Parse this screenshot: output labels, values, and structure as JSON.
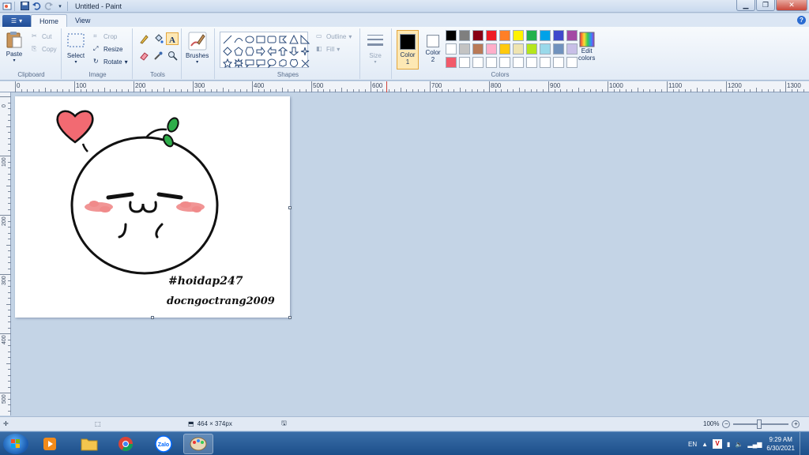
{
  "window": {
    "title": "Untitled - Paint"
  },
  "tabs": [
    {
      "label": "Home",
      "active": true
    },
    {
      "label": "View",
      "active": false
    }
  ],
  "ribbon": {
    "clipboard": {
      "label": "Clipboard",
      "paste": "Paste",
      "cut": "Cut",
      "copy": "Copy"
    },
    "image": {
      "label": "Image",
      "select": "Select",
      "crop": "Crop",
      "resize": "Resize",
      "rotate": "Rotate"
    },
    "tools": {
      "label": "Tools"
    },
    "brushes": {
      "label": "Brushes"
    },
    "shapes": {
      "label": "Shapes",
      "outline": "Outline",
      "fill": "Fill"
    },
    "size": {
      "label": "Size"
    },
    "colors": {
      "label": "Colors",
      "color1": "Color",
      "color1_num": "1",
      "color2": "Color",
      "color2_num": "2",
      "edit": "Edit",
      "edit2": "colors",
      "color1_value": "#000000",
      "color2_value": "#ffffff",
      "palette_row1": [
        "#000000",
        "#7f7f7f",
        "#880015",
        "#ed1c24",
        "#ff7f27",
        "#fff200",
        "#22b14c",
        "#00a2e8",
        "#3f48cc",
        "#a349a4"
      ],
      "palette_row2": [
        "#ffffff",
        "#c3c3c3",
        "#b97a57",
        "#ffaec9",
        "#ffc90e",
        "#efe4b0",
        "#b5e61d",
        "#99d9ea",
        "#7092be",
        "#c8bfe7"
      ],
      "palette_row3": [
        "#f25a6a",
        "#ffffff",
        "#ffffff",
        "#ffffff",
        "#ffffff",
        "#ffffff",
        "#ffffff",
        "#ffffff",
        "#ffffff",
        "#ffffff"
      ]
    }
  },
  "ruler": {
    "h_labels": [
      "0",
      "100",
      "200",
      "300",
      "400",
      "500",
      "600",
      "700",
      "800",
      "900",
      "1000",
      "1100",
      "1200",
      "1300"
    ],
    "v_labels": [
      "0",
      "100",
      "200",
      "300",
      "400",
      "500"
    ]
  },
  "canvas": {
    "text1": "#hoidap247",
    "text2": "docngoctrang2009"
  },
  "status": {
    "dimensions": "464 × 374px",
    "zoom": "100%"
  },
  "taskbar": {
    "lang": "EN",
    "time": "9:29 AM",
    "date": "6/30/2021",
    "zalo": "Zalo"
  }
}
